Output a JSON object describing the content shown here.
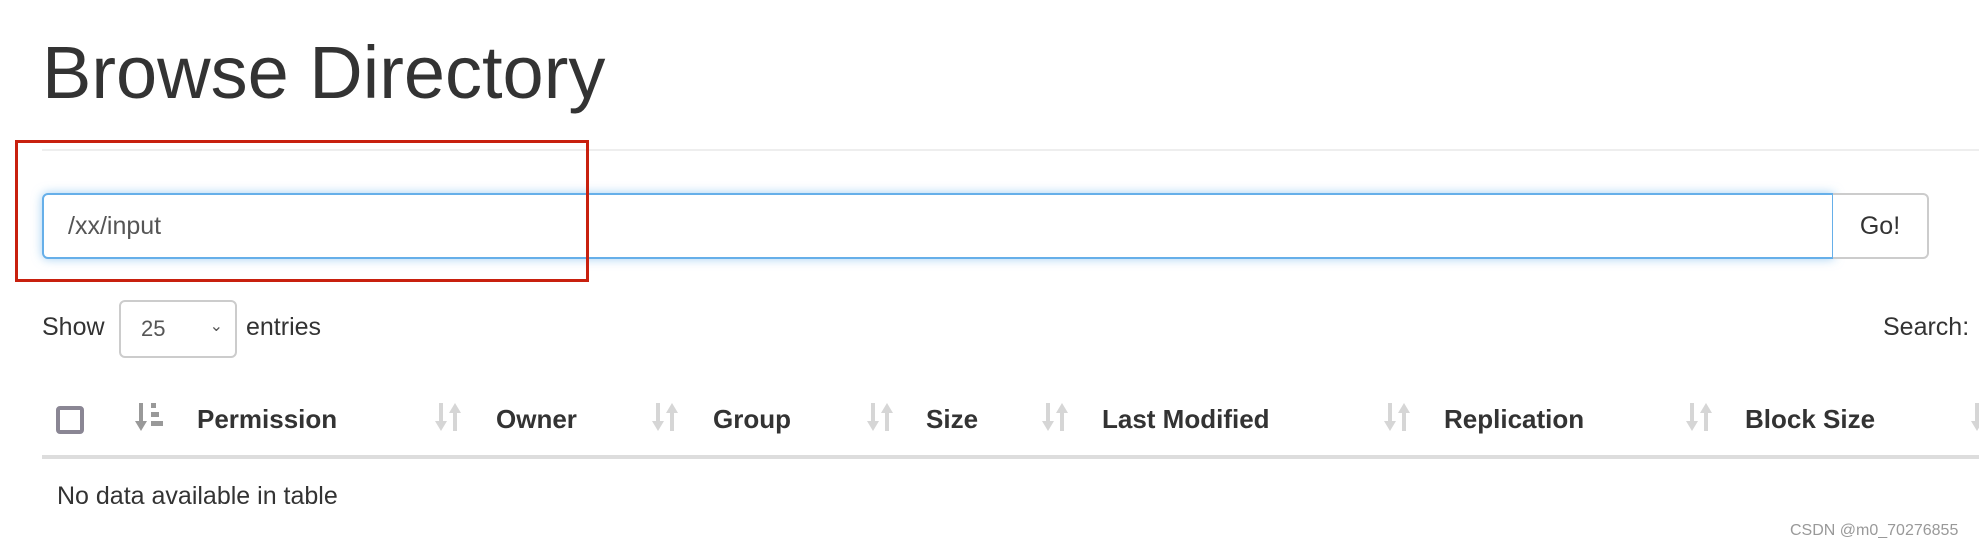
{
  "page": {
    "title": "Browse Directory"
  },
  "path_bar": {
    "value": "/xx/input",
    "go_label": "Go!"
  },
  "length": {
    "show_label": "Show",
    "selected": "25",
    "entries_label": "entries"
  },
  "search": {
    "label": "Search:"
  },
  "table": {
    "columns": [
      "Permission",
      "Owner",
      "Group",
      "Size",
      "Last Modified",
      "Replication",
      "Block Size"
    ],
    "empty_message": "No data available in table"
  },
  "watermark": "CSDN @m0_70276855",
  "colors": {
    "focus_border": "#66afe9",
    "highlight_box": "#c8200e",
    "sort_icon_inactive": "#d6d6d6",
    "sort_icon_active": "#999999"
  }
}
